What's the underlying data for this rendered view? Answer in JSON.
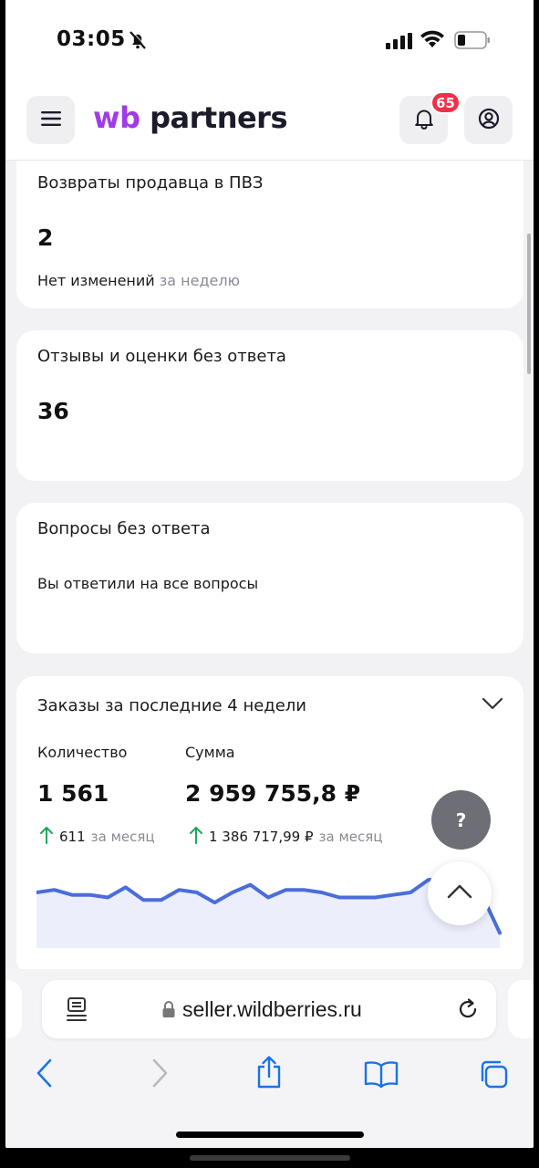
{
  "status_bar": {
    "time": "03:05"
  },
  "app_header": {
    "logo_wb": "wb",
    "logo_partners": "partners",
    "notification_count": "65"
  },
  "cards": {
    "returns": {
      "title": "Возвраты продавца в ПВЗ",
      "value": "2",
      "change": "Нет изменений",
      "period": "за неделю"
    },
    "reviews": {
      "title": "Отзывы и оценки без ответа",
      "value": "36"
    },
    "questions": {
      "title": "Вопросы без ответа",
      "message": "Вы ответили на все вопросы"
    },
    "orders": {
      "title": "Заказы за последние 4 недели",
      "count_label": "Количество",
      "count_value": "1 561",
      "count_delta": "611",
      "count_period": "за месяц",
      "sum_label": "Сумма",
      "sum_value": "2 959 755,8 ₽",
      "sum_delta": "1 386 717,99 ₽",
      "sum_period": "за месяц"
    }
  },
  "help_button": {
    "label": "?"
  },
  "browser": {
    "url": "seller.wildberries.ru"
  },
  "colors": {
    "brand_purple": "#a13be8",
    "badge_red": "#f0304a",
    "chart_line": "#4a6cdc",
    "chart_fill": "#eceefb",
    "up_green": "#22a55b",
    "ios_blue": "#1a73e8"
  },
  "chart_data": {
    "type": "area",
    "series": [
      {
        "values": [
          57,
          58,
          56,
          56,
          55,
          59,
          54,
          54,
          58,
          57,
          53,
          57,
          60,
          55,
          58,
          58,
          57,
          55,
          55,
          55,
          56,
          57,
          62,
          62,
          61,
          56,
          41
        ]
      }
    ]
  }
}
